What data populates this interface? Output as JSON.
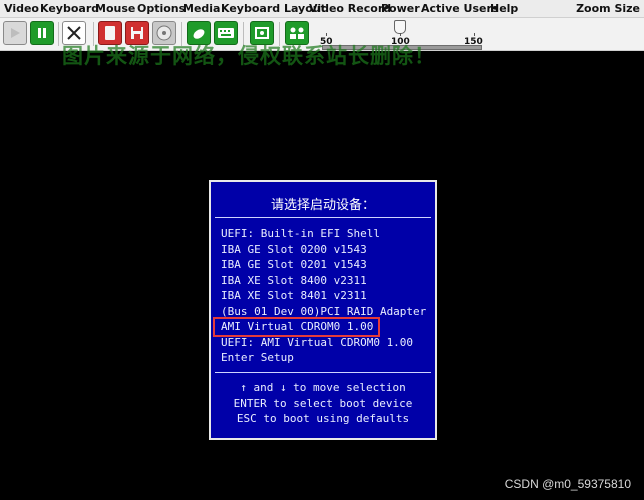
{
  "menu": {
    "items": [
      "Video",
      "Keyboard",
      "Mouse",
      "Options",
      "Media",
      "Keyboard Layout",
      "Video Record",
      "Power",
      "Active Users",
      "Help"
    ],
    "zoom_label": "Zoom Size"
  },
  "toolbar": {
    "icons": [
      "play-icon",
      "pause-icon",
      "fullscreen-icon",
      "record-icon",
      "save-icon",
      "cd-icon",
      "mouse-icon",
      "keyboard-icon",
      "virtual-media-icon",
      "users-icon"
    ],
    "colors": {
      "green": "#1f9b2a",
      "red": "#d03030",
      "gray": "#c8c8c8"
    }
  },
  "zoom": {
    "labels": [
      "50",
      "100",
      "150"
    ],
    "value": 100,
    "min": 50,
    "max": 150
  },
  "watermark": "图片来源于网络，侵权联系站长删除！",
  "boot_menu": {
    "title": "请选择启动设备：",
    "items": [
      "UEFI: Built-in EFI Shell",
      "IBA GE Slot 0200 v1543",
      "IBA GE Slot 0201 v1543",
      "IBA XE Slot 8400 v2311",
      "IBA XE Slot 8401 v2311",
      "(Bus 01 Dev 00)PCI RAID Adapter",
      "AMI Virtual CDROM0 1.00",
      "UEFI: AMI Virtual CDROM0 1.00",
      "Enter Setup"
    ],
    "selected_index": 6,
    "help": [
      "↑ and ↓ to move selection",
      "ENTER to select boot device",
      "ESC to boot using defaults"
    ]
  },
  "credit": "CSDN @m0_59375810"
}
